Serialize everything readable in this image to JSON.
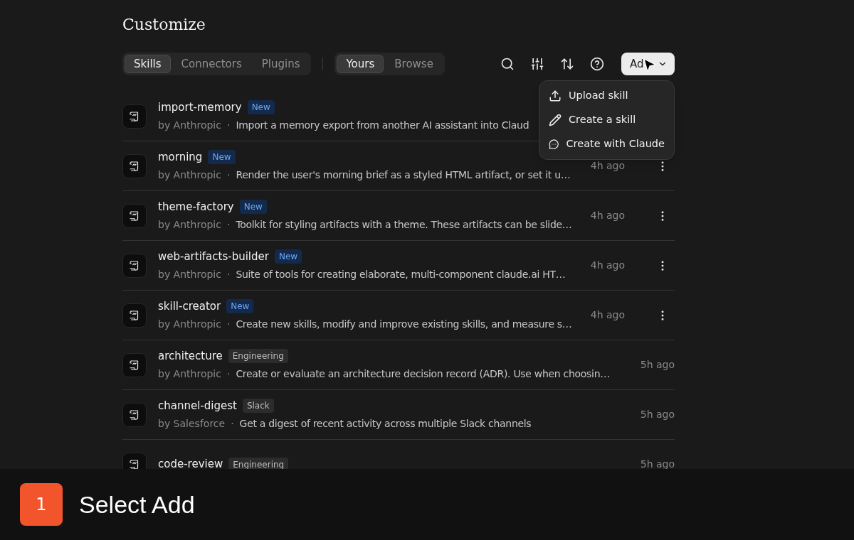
{
  "page": {
    "title": "Customize"
  },
  "category_tabs": [
    {
      "label": "Skills",
      "selected": true
    },
    {
      "label": "Connectors",
      "selected": false
    },
    {
      "label": "Plugins",
      "selected": false
    }
  ],
  "scope_tabs": [
    {
      "label": "Yours",
      "selected": true
    },
    {
      "label": "Browse",
      "selected": false
    }
  ],
  "add_button": {
    "label": "Ad"
  },
  "add_menu": [
    {
      "label": "Upload skill",
      "kind": "upload"
    },
    {
      "label": "Create a skill",
      "kind": "pencil"
    },
    {
      "label": "Create with Claude",
      "kind": "chat"
    }
  ],
  "skills": [
    {
      "name": "import-memory",
      "tag": "New",
      "kind": "new",
      "author": "by Anthropic",
      "separator": "·",
      "description": "Import a memory export from another AI assistant into Claud"
    },
    {
      "name": "morning",
      "tag": "New",
      "kind": "new",
      "author": "by Anthropic",
      "separator": "·",
      "description": "Render the user's morning brief as a styled HTML artifact, or set it u…",
      "time": "4h ago",
      "more_menu": true
    },
    {
      "name": "theme-factory",
      "tag": "New",
      "kind": "new",
      "author": "by Anthropic",
      "separator": "·",
      "description": "Toolkit for styling artifacts with a theme. These artifacts can be slide…",
      "time": "4h ago",
      "more_menu": true
    },
    {
      "name": "web-artifacts-builder",
      "tag": "New",
      "kind": "new",
      "author": "by Anthropic",
      "separator": "·",
      "description": "Suite of tools for creating elaborate, multi-component claude.ai HT…",
      "time": "4h ago",
      "more_menu": true
    },
    {
      "name": "skill-creator",
      "tag": "New",
      "kind": "new",
      "author": "by Anthropic",
      "separator": "·",
      "description": "Create new skills, modify and improve existing skills, and measure s…",
      "time": "4h ago",
      "more_menu": true
    },
    {
      "name": "architecture",
      "tag": "Engineering",
      "kind": "plain",
      "author": "by Anthropic",
      "separator": "·",
      "description": "Create or evaluate an architecture decision record (ADR). Use when choosin…",
      "time": "5h ago"
    },
    {
      "name": "channel-digest",
      "tag": "Slack",
      "kind": "plain",
      "author": "by Salesforce",
      "separator": "·",
      "description": "Get a digest of recent activity across multiple Slack channels",
      "time": "5h ago"
    },
    {
      "name": "code-review",
      "tag": "Engineering",
      "kind": "plain",
      "time": "5h ago"
    }
  ],
  "step": {
    "number": "1",
    "instruction": "Select Add"
  }
}
